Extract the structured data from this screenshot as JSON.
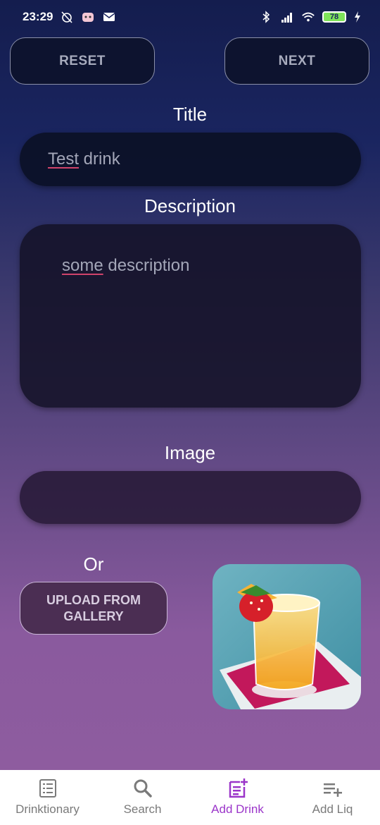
{
  "status_bar": {
    "time": "23:29",
    "battery": "78"
  },
  "top_buttons": {
    "reset": "RESET",
    "next": "NEXT"
  },
  "form": {
    "title_label": "Title",
    "title_value": [
      "Test",
      " drink"
    ],
    "description_label": "Description",
    "description_value": [
      "some",
      " description"
    ],
    "image_label": "Image",
    "or_label": "Or",
    "upload_button": "UPLOAD FROM GALLERY"
  },
  "nav": {
    "items": [
      {
        "label": "Drinktionary",
        "icon": "list-icon"
      },
      {
        "label": "Search",
        "icon": "search-icon"
      },
      {
        "label": "Add Drink",
        "icon": "add-note-icon",
        "active": true
      },
      {
        "label": "Add Liq",
        "icon": "playlist-add-icon"
      }
    ]
  },
  "colors": {
    "accent": "#9b35c9",
    "field_bg": "#0b1026",
    "upload_bg": "#4b2e53"
  }
}
